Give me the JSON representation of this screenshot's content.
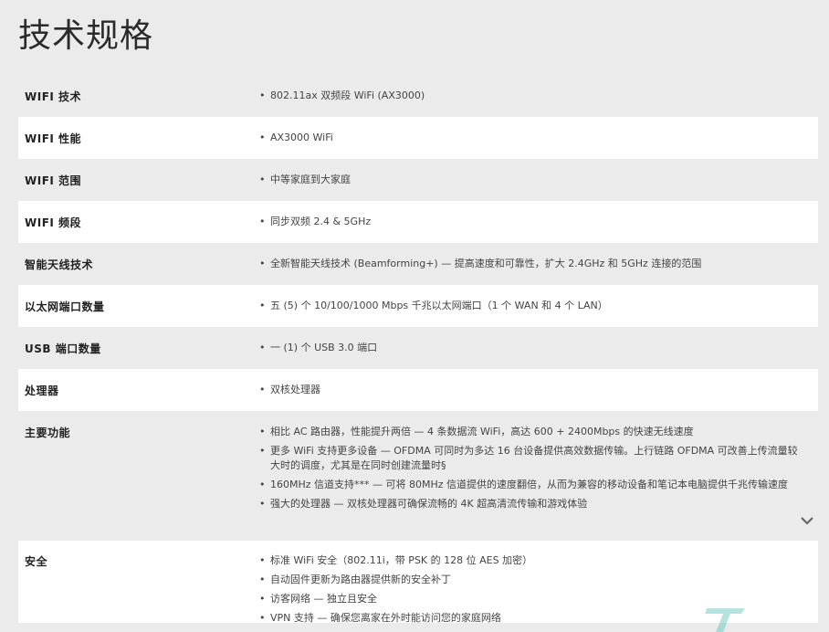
{
  "title": "技术规格",
  "specs": [
    {
      "label": "WIFI 技术",
      "values": [
        "802.11ax 双频段 WiFi (AX3000)"
      ]
    },
    {
      "label": "WIFI 性能",
      "values": [
        "AX3000 WiFi"
      ]
    },
    {
      "label": "WIFI 范围",
      "values": [
        "中等家庭到大家庭"
      ]
    },
    {
      "label": "WIFI 频段",
      "values": [
        "同步双频 2.4 & 5GHz"
      ]
    },
    {
      "label": "智能天线技术",
      "values": [
        "全新智能天线技术 (Beamforming+) — 提高速度和可靠性，扩大 2.4GHz 和 5GHz 连接的范围"
      ]
    },
    {
      "label": "以太网端口数量",
      "values": [
        "五 (5) 个 10/100/1000 Mbps 千兆以太网端口（1 个 WAN 和 4 个 LAN）"
      ]
    },
    {
      "label": "USB 端口数量",
      "values": [
        "一 (1) 个 USB 3.0 端口"
      ]
    },
    {
      "label": "处理器",
      "values": [
        "双核处理器"
      ]
    },
    {
      "label": "主要功能",
      "values": [
        "相比 AC 路由器，性能提升两倍 — 4 条数据流 WiFi，高达 600 + 2400Mbps 的快速无线速度",
        "更多 WiFi 支持更多设备 — OFDMA 可同时为多达 16 台设备提供高效数据传输。上行链路 OFDMA 可改善上传流量较大时的调度，尤其是在同时创建流量时§",
        "160MHz 信道支持*** — 可将 80MHz 信道提供的速度翻倍，从而为兼容的移动设备和笔记本电脑提供千兆传输速度",
        "强大的处理器 — 双核处理器可确保流畅的 4K 超高清流传输和游戏体验"
      ]
    },
    {
      "label": "安全",
      "values": [
        "标准 WiFi 安全（802.11i，带 PSK 的 128 位 AES 加密）",
        "自动固件更新为路由器提供新的安全补丁",
        "访客网络 — 独立且安全",
        "VPN 支持 — 确保您离家在外时能访问您的家庭网络"
      ]
    }
  ],
  "icons": {
    "expand": "chevron-down-icon",
    "logo": "watermark-logo"
  },
  "colors": {
    "background": "#ebebeb",
    "row_alt": "#ffffff",
    "text": "#333333"
  }
}
